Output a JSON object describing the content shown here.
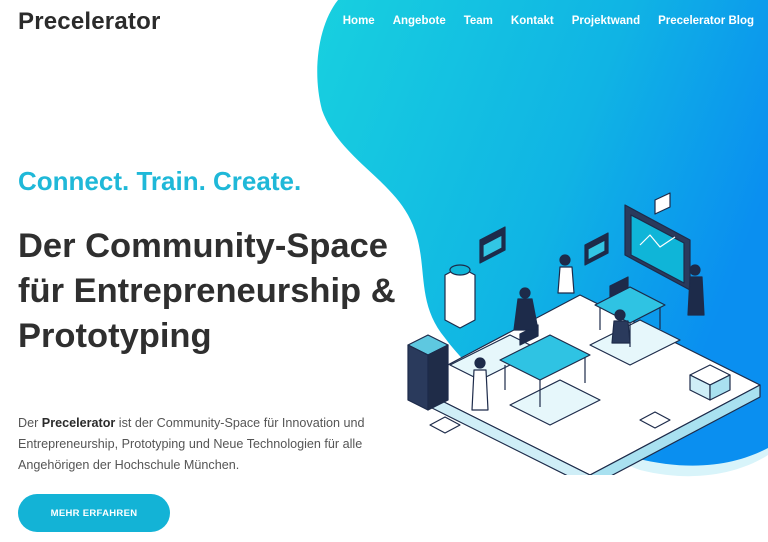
{
  "brand": {
    "name": "Precelerator"
  },
  "nav": {
    "items": [
      "Home",
      "Angebote",
      "Team",
      "Kontakt",
      "Projektwand",
      "Precelerator Blog"
    ]
  },
  "hero": {
    "tagline": "Connect. Train. Create.",
    "headline": "Der Community-Space für Entrepreneurship & Prototyping",
    "desc_prefix": "Der ",
    "desc_brand": "Precelerator",
    "desc_suffix": " ist der Community-Space für Innovation und Entrepreneurship, Prototyping und Neue Technologien für alle Angehörigen der Hochschule München.",
    "cta_label": "MEHR ERFAHREN"
  },
  "colors": {
    "accent": "#13b3d6",
    "gradient_start": "#16cbe0",
    "gradient_end": "#0a8ff0",
    "text": "#2f2f2f"
  },
  "illustration": {
    "name": "isometric-coworking-space-illustration"
  }
}
